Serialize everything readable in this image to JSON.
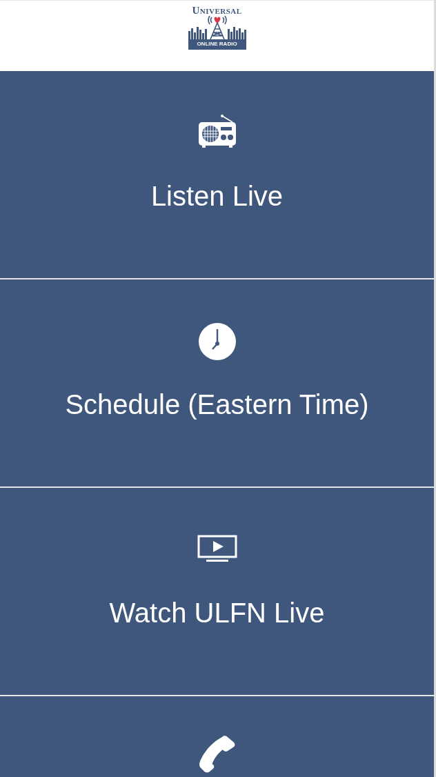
{
  "header": {
    "logo": {
      "title": "UNIVERSAL",
      "subtitle": "ONLINE RADIO"
    }
  },
  "tiles": [
    {
      "kind": "radio",
      "label": "Listen Live"
    },
    {
      "kind": "clock",
      "label": "Schedule (Eastern Time)"
    },
    {
      "kind": "tv",
      "label": "Watch ULFN Live"
    },
    {
      "kind": "phone"
    }
  ]
}
